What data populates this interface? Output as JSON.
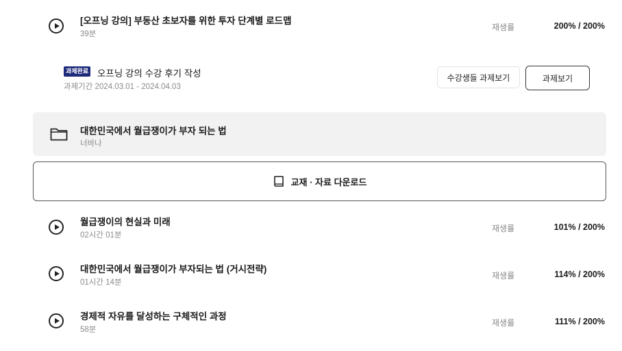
{
  "lectures_top": [
    {
      "title": "[오프닝 강의] 부동산 초보자를 위한 투자 단계별 로드맵",
      "duration": "39분",
      "rate_label": "재생률",
      "rate": "200% / 200%"
    }
  ],
  "assignment": {
    "badge": "과제완료",
    "title": "오프닝 강의 수강 후기 작성",
    "period": "과제기간 2024.03.01 - 2024.04.03",
    "students_button": "수강생들 과제보기",
    "view_button": "과제보기"
  },
  "folder": {
    "title": "대한민국에서 월급쟁이가 부자 되는 법",
    "author": "너바나"
  },
  "download": {
    "label": "교재 · 자료 다운로드"
  },
  "lectures": [
    {
      "title": "월급쟁이의 현실과 미래",
      "duration": "02시간 01분",
      "rate_label": "재생률",
      "rate": "101% / 200%"
    },
    {
      "title": "대한민국에서 월급쟁이가 부자되는 법 (거시전략)",
      "duration": "01시간 14분",
      "rate_label": "재생률",
      "rate": "114% / 200%"
    },
    {
      "title": "경제적 자유를 달성하는 구체적인 과정",
      "duration": "58분",
      "rate_label": "재생률",
      "rate": "111% / 200%"
    }
  ],
  "colors": {
    "badge_bg": "#1e2a7a",
    "folder_bg": "#f2f2f2"
  }
}
